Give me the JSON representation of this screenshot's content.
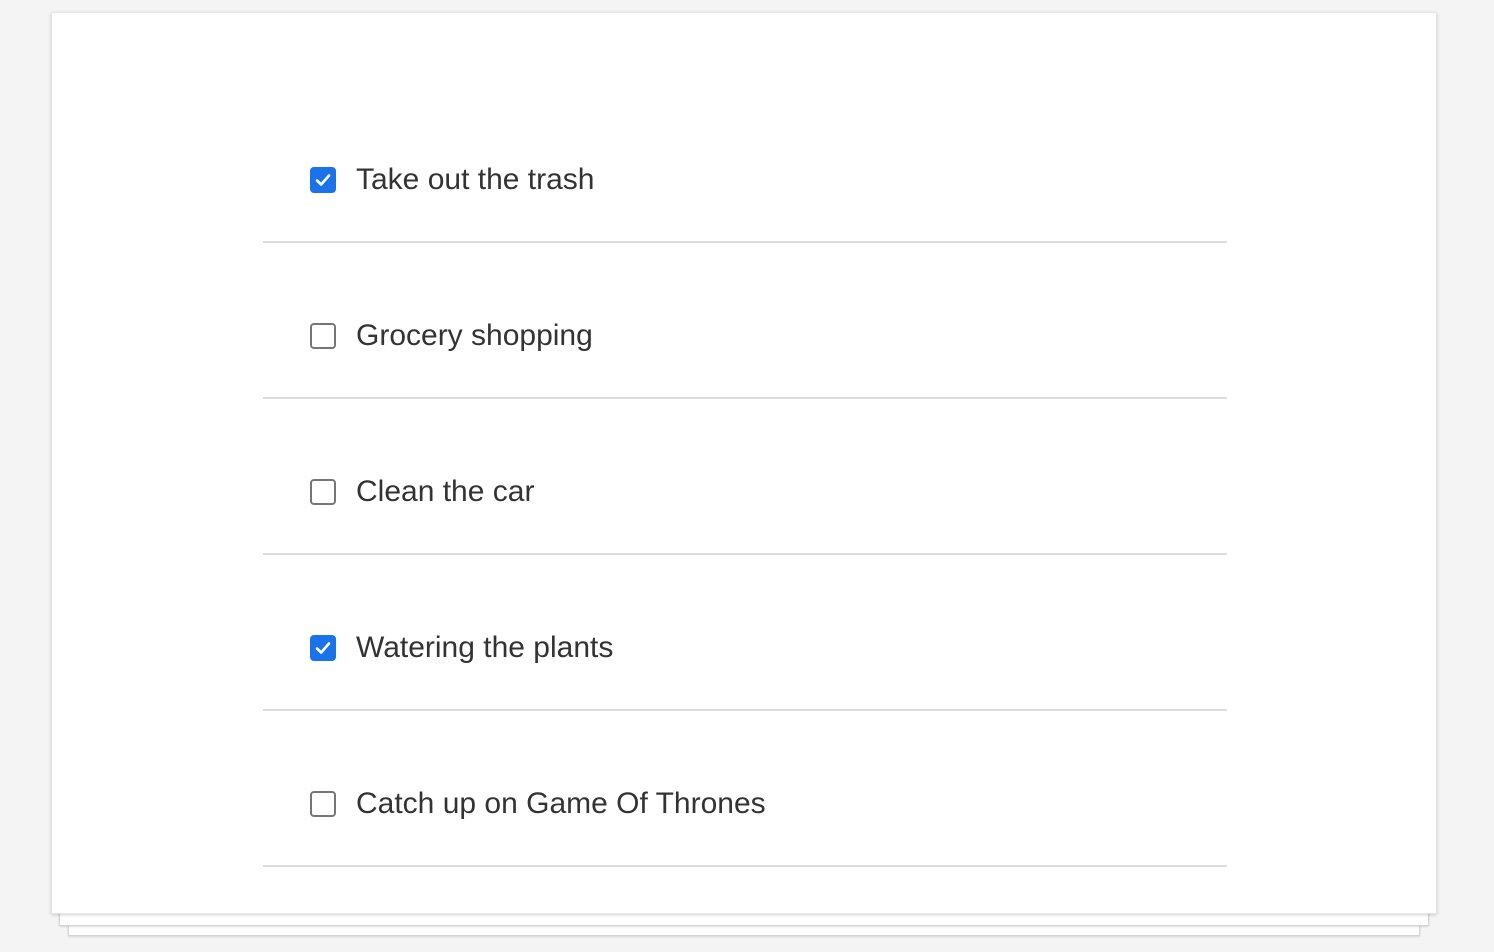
{
  "todos": [
    {
      "label": "Take out the trash",
      "checked": true
    },
    {
      "label": "Grocery shopping",
      "checked": false
    },
    {
      "label": "Clean the car",
      "checked": false
    },
    {
      "label": "Watering the plants",
      "checked": true
    },
    {
      "label": "Catch up on Game Of Thrones",
      "checked": false
    }
  ],
  "colors": {
    "accent": "#1a73e8",
    "text": "#333333",
    "divider": "#dcdcdc",
    "background": "#f4f4f4"
  }
}
